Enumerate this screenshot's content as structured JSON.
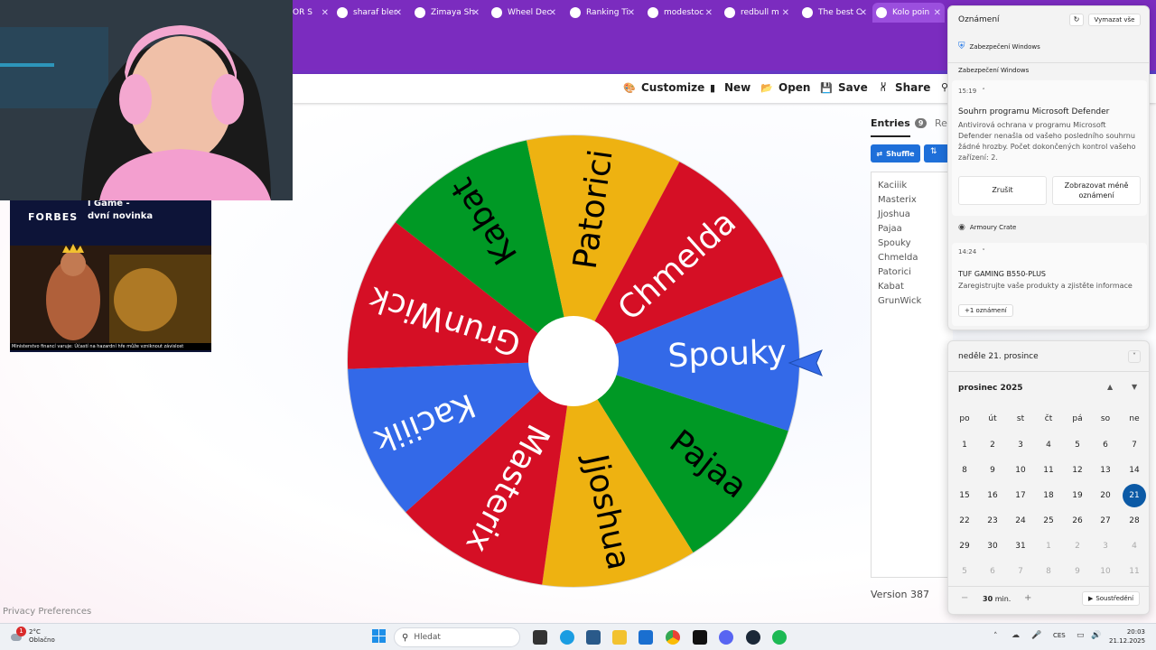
{
  "browser": {
    "tabs": [
      {
        "label": "OR S",
        "icon": "generic-icon"
      },
      {
        "label": "sharaf bler",
        "icon": "google-icon"
      },
      {
        "label": "Zimaya Sh",
        "icon": "bookmark-icon"
      },
      {
        "label": "Wheel Dec",
        "icon": "chrome-icon"
      },
      {
        "label": "Ranking Ti",
        "icon": "youtube-icon"
      },
      {
        "label": "modestoc",
        "icon": "diamond-icon"
      },
      {
        "label": "redbull m",
        "icon": "google-icon"
      },
      {
        "label": "The best C",
        "icon": "diamond-icon"
      },
      {
        "label": "Kolo poin",
        "icon": "wheel-icon"
      }
    ]
  },
  "toolbar": {
    "customize": "Customize",
    "new": "New",
    "open": "Open",
    "save": "Save",
    "share": "Share"
  },
  "wheel": {
    "segments": [
      {
        "label": "Spouky",
        "color": "#3369e8"
      },
      {
        "label": "Pajaa",
        "color": "#009925"
      },
      {
        "label": "Jjoshua",
        "color": "#eeb211"
      },
      {
        "label": "Masterix",
        "color": "#d50f25"
      },
      {
        "label": "Kaciiik",
        "color": "#3369e8"
      },
      {
        "label": "GrunWick",
        "color": "#d50f25"
      },
      {
        "label": "Kabat",
        "color": "#009925"
      },
      {
        "label": "Patorici",
        "color": "#eeb211"
      },
      {
        "label": "Chmelda",
        "color": "#d50f25"
      }
    ]
  },
  "entries": {
    "tab_label": "Entries",
    "count": "9",
    "results_label": "Res",
    "shuffle_label": "Shuffle",
    "items": [
      "Kaciiik",
      "Masterix",
      "Jjoshua",
      "Pajaa",
      "Spouky",
      "Chmelda",
      "Patorici",
      "Kabat",
      "GrunWick"
    ],
    "version": "Version 387"
  },
  "privacy": "Privacy Preferences",
  "ad": {
    "brand": "FORBES",
    "headline": "l Game -\ndvní novinka",
    "disclaimer": "Ministerstvo financí varuje: Účastí na hazardní hře může vzniknout závislost"
  },
  "notifications": {
    "title": "Oznámení",
    "clear_all": "Vymazat vše",
    "groups": [
      {
        "app": "Zabezpečení Windows",
        "subheader": "Zabezpečení Windows",
        "time": "15:19",
        "heading": "Souhrn programu Microsoft Defender",
        "body": "Antivirová ochrana v programu Microsoft Defender nenašla od vašeho posledního souhrnu žádné hrozby. Počet dokončených kontrol vašeho zařízení: 2.",
        "actions": [
          "Zrušit",
          "Zobrazovat méně oznámení"
        ]
      },
      {
        "app": "Armoury Crate",
        "time": "14:24",
        "heading": "TUF GAMING B550-PLUS",
        "body": "Zaregistrujte vaše produkty a zjistěte informace",
        "more": "+1 oznámení"
      }
    ]
  },
  "calendar": {
    "date_header": "neděle 21. prosince",
    "month": "prosinec 2025",
    "weekdays": [
      "po",
      "út",
      "st",
      "čt",
      "pá",
      "so",
      "ne"
    ],
    "weeks": [
      [
        "1",
        "2",
        "3",
        "4",
        "5",
        "6",
        "7"
      ],
      [
        "8",
        "9",
        "10",
        "11",
        "12",
        "13",
        "14"
      ],
      [
        "15",
        "16",
        "17",
        "18",
        "19",
        "20",
        "21"
      ],
      [
        "22",
        "23",
        "24",
        "25",
        "26",
        "27",
        "28"
      ],
      [
        "29",
        "30",
        "31",
        "1",
        "2",
        "3",
        "4"
      ],
      [
        "5",
        "6",
        "7",
        "8",
        "9",
        "10",
        "11"
      ]
    ],
    "today": "21",
    "focus_minutes": "30",
    "focus_unit": "min.",
    "focus_label": "Soustředění"
  },
  "taskbar": {
    "weather_temp": "2°C",
    "weather_desc": "Oblačno",
    "weather_badge": "1",
    "search_placeholder": "Hledat",
    "lang": "CES",
    "time": "20:03",
    "date": "21.12.2025"
  }
}
